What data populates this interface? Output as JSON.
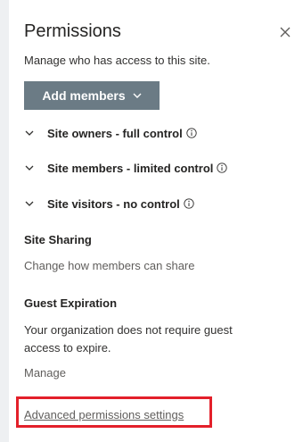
{
  "panel": {
    "title": "Permissions",
    "subtitle": "Manage who has access to this site.",
    "close_icon": "close-icon"
  },
  "add_members": {
    "label": "Add members",
    "icon": "chevron-down-icon"
  },
  "groups": [
    {
      "label": "Site owners - full control",
      "icon": "info-icon"
    },
    {
      "label": "Site members - limited control",
      "icon": "info-icon"
    },
    {
      "label": "Site visitors - no control",
      "icon": "info-icon"
    }
  ],
  "site_sharing": {
    "title": "Site Sharing",
    "link": "Change how members can share"
  },
  "guest_expiration": {
    "title": "Guest Expiration",
    "text": "Your organization does not require guest access to expire.",
    "link": "Manage"
  },
  "advanced": {
    "link": "Advanced permissions settings",
    "highlight_color": "#e3202a"
  },
  "colors": {
    "button_bg": "#6b7b85",
    "text": "#252423",
    "muted": "#605e5c"
  }
}
